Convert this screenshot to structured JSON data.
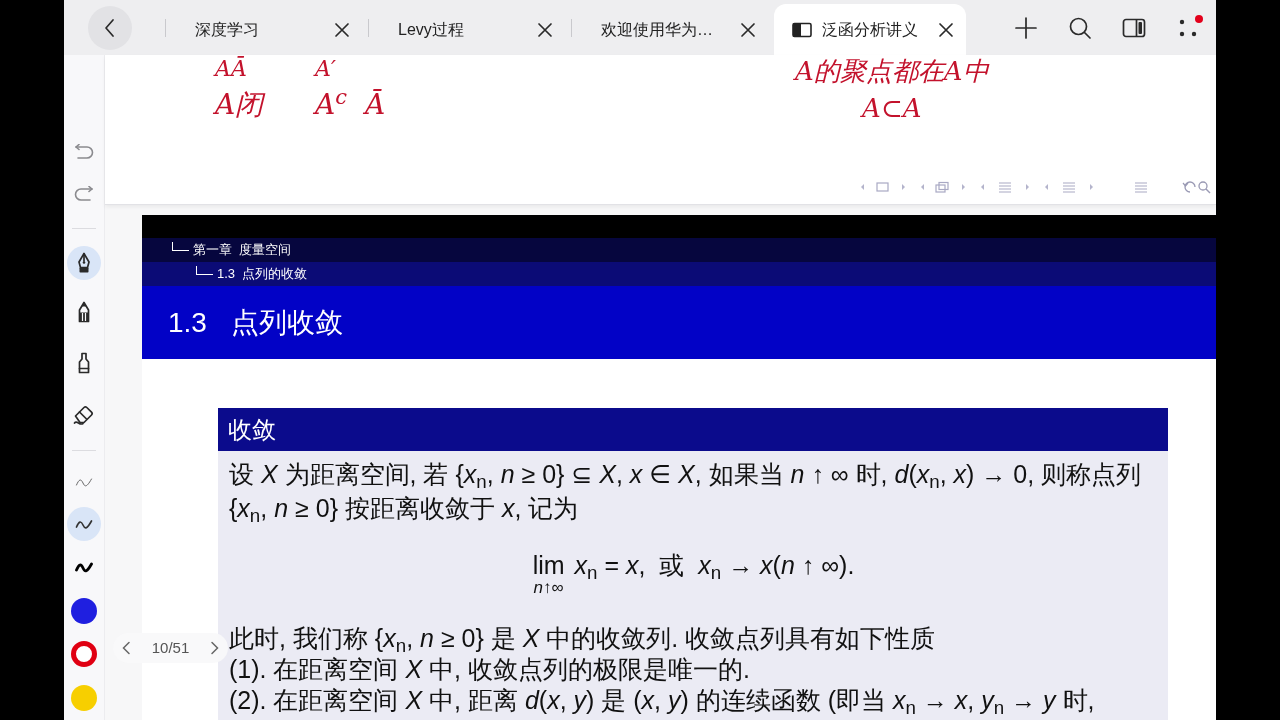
{
  "browser_tabs": [
    {
      "title": "深度学习",
      "selected": false
    },
    {
      "title": "Levy过程",
      "selected": false
    },
    {
      "title": "欢迎使用华为…",
      "selected": false
    },
    {
      "title": "泛函分析讲义",
      "selected": true
    }
  ],
  "pen_toolbar": {
    "tools": [
      {
        "kind": "fountain-pen",
        "selected": true
      },
      {
        "kind": "marker",
        "selected": false
      },
      {
        "kind": "highlighter",
        "selected": false
      },
      {
        "kind": "eraser",
        "selected": false
      }
    ],
    "stroke_widths": [
      {
        "kind": "thin",
        "selected": false
      },
      {
        "kind": "medium",
        "selected": true
      },
      {
        "kind": "thick",
        "selected": false
      }
    ],
    "colors": [
      {
        "color": "#1f1fe0",
        "selected": false
      },
      {
        "color": "#e00012",
        "selected": true
      },
      {
        "color": "#f7cf00",
        "selected": false
      }
    ]
  },
  "handwritten_notes": {
    "left_rows": [
      [
        "AĀ",
        "A′"
      ],
      [
        "A闭",
        "A$^{c}$",
        "Ā"
      ]
    ],
    "right_lines": [
      "A的聚点都在A中",
      "A⊂A"
    ]
  },
  "slide": {
    "breadcrumb": [
      {
        "label": "第一章  度量空间",
        "children": [
          {
            "label": "1.3  点列的收敛"
          }
        ]
      }
    ],
    "frame_number": "1.3",
    "frame_title": "点列收敛",
    "block": {
      "title": "收敛",
      "body": [
        {
          "kind": "text",
          "text": "设 *X* 为距离空间, 若 {*x*$_{n}$, *n* ≥ 0} ⊆ *X*, *x* ∈ *X*, 如果当 *n* ↑ ∞ 时, *d*(*x*$_{n}$, *x*) → 0, 则称点列 {*x*$_{n}$, *n* ≥ 0} 按距离收敛于 *x*, 记为"
        },
        {
          "kind": "equation",
          "operator": "lim",
          "under": "*n*↑∞",
          "text": "*x*$_{n}$ = *x*,  或  *x*$_{n}$ → *x*(*n* ↑ ∞)."
        },
        {
          "kind": "text",
          "text": "此时, 我们称 {*x*$_{n}$, *n* ≥ 0} 是 *X* 中的收敛列. 收敛点列具有如下性质"
        },
        {
          "kind": "text",
          "text": "(1). 在距离空间 *X* 中, 收敛点列的极限是唯一的."
        },
        {
          "kind": "text",
          "text": "(2). 在距离空间 *X* 中, 距离 *d*(*x*, *y*) 是 (*x*, *y*) 的连续函数 (即当 *x*$_{n}$ → *x*, *y*$_{n}$ → *y* 时,"
        }
      ]
    }
  },
  "page_indicator": {
    "text": "10/51"
  }
}
